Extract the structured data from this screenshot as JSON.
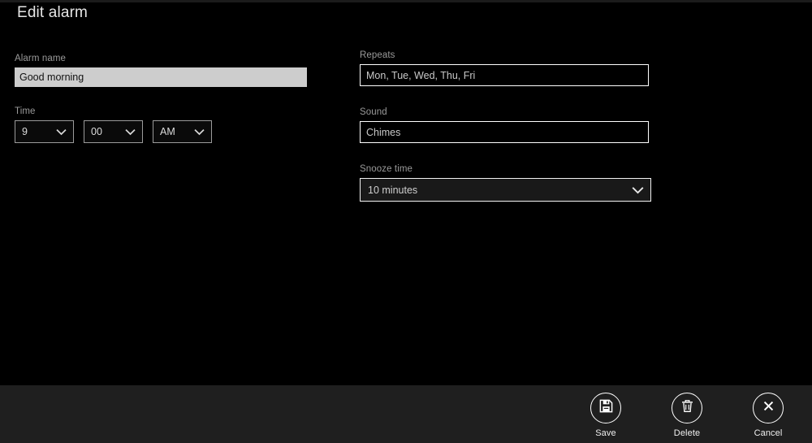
{
  "window": {
    "title": "Edit alarm"
  },
  "form": {
    "alarm_name": {
      "label": "Alarm name",
      "value": "Good morning",
      "placeholder": "Alarm name"
    },
    "time": {
      "label": "Time",
      "hour": "9",
      "minute": "00",
      "period": "AM"
    },
    "repeats": {
      "label": "Repeats",
      "value": "Mon, Tue, Wed, Thu, Fri",
      "placeholder": "Repeats"
    },
    "sound": {
      "label": "Sound",
      "value": "Chimes",
      "placeholder": "Sound"
    },
    "snooze": {
      "label": "Snooze time",
      "value": "10 minutes"
    }
  },
  "appbar": {
    "buttons": [
      {
        "label": "Save",
        "icon": "save-icon"
      },
      {
        "label": "Delete",
        "icon": "trash-icon"
      },
      {
        "label": "Cancel",
        "icon": "close-x-icon"
      }
    ]
  },
  "colors": {
    "background": "#000000",
    "appbar": "#1f1f1f",
    "label": "#9a9a9a",
    "text": "#e8e8e8",
    "focused_field_bg": "#cdcdcd",
    "border_light": "#ffffff",
    "border_grey": "#9b9b9b"
  }
}
